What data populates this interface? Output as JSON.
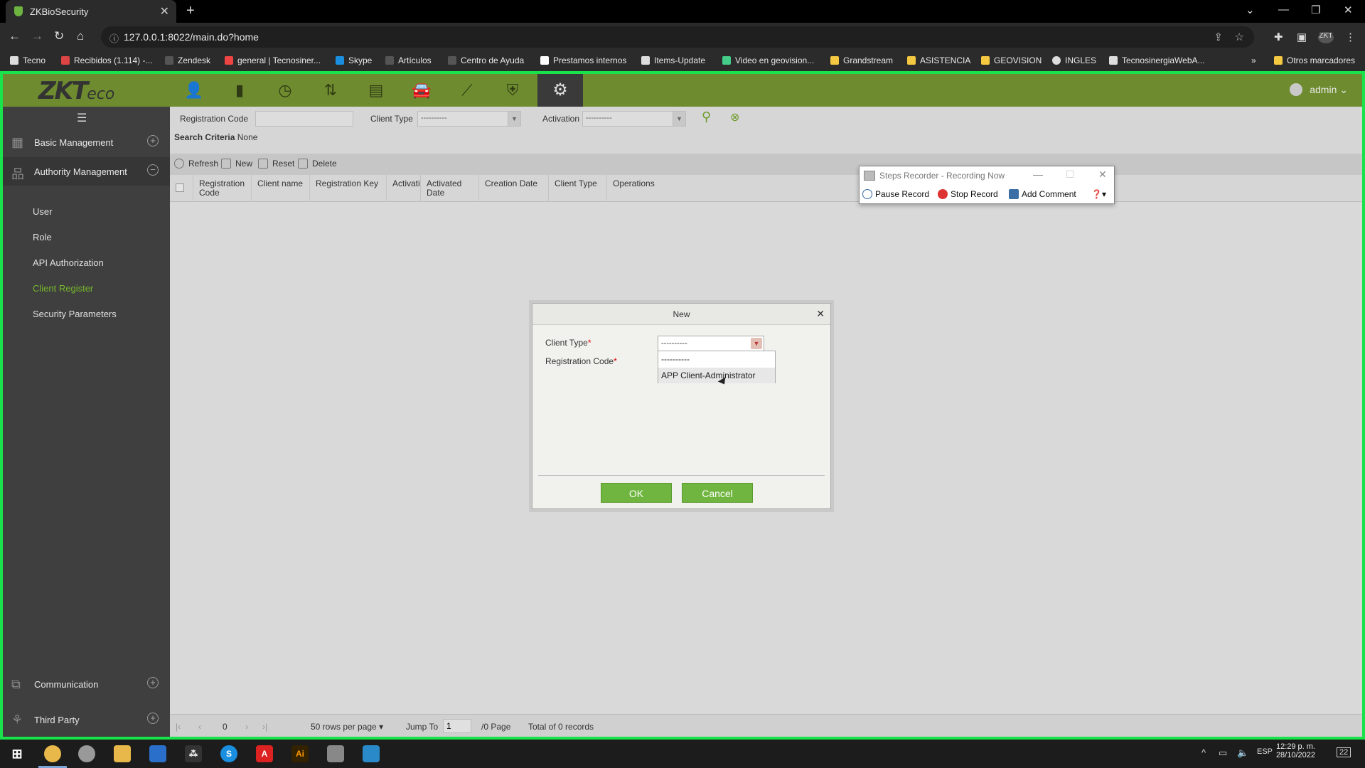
{
  "browser": {
    "tab_title": "ZKBioSecurity",
    "url": "127.0.0.1:8022/main.do?home",
    "bookmarks": [
      "Tecno",
      "Recibidos (1.114) -...",
      "Zendesk",
      "general | Tecnosiner...",
      "Skype",
      "Artículos",
      "Centro de Ayuda",
      "Prestamos internos",
      "Items-Update",
      "Video en geovision...",
      "Grandstream",
      "ASISTENCIA",
      "GEOVISION",
      "INGLES",
      "TecnosinergiaWebA..."
    ],
    "other_bookmarks": "Otros marcadores",
    "profile": "ZKT"
  },
  "header": {
    "logo": "ZKT",
    "logo_suffix": "eco",
    "user": "admin"
  },
  "sidebar": {
    "sections": {
      "basic": "Basic Management",
      "authority": "Authority Management",
      "communication": "Communication",
      "third_party": "Third Party"
    },
    "items": [
      "User",
      "Role",
      "API Authorization",
      "Client Register",
      "Security Parameters"
    ]
  },
  "filters": {
    "registration_code_label": "Registration Code",
    "client_type_label": "Client Type",
    "client_type_value": "----------",
    "activation_label": "Activation",
    "activation_value": "----------",
    "search_criteria_label": "Search Criteria",
    "search_criteria_value": "None"
  },
  "toolbar": {
    "refresh": "Refresh",
    "new": "New",
    "reset": "Reset",
    "delete": "Delete"
  },
  "table": {
    "columns": [
      "Registration Code",
      "Client name",
      "Registration Key",
      "Activation",
      "Activated Date",
      "Creation Date",
      "Client Type",
      "Operations"
    ]
  },
  "pager": {
    "page_index": "0",
    "rows_per_page": "50 rows per page",
    "jump_to_label": "Jump To",
    "jump_value": "1",
    "page_total": "/0 Page",
    "total_records": "Total of 0 records"
  },
  "modal": {
    "title": "New",
    "client_type_label": "Client Type",
    "registration_code_label": "Registration Code",
    "client_type_value": "----------",
    "options": [
      "----------",
      "APP Client-Administrator"
    ],
    "ok": "OK",
    "cancel": "Cancel"
  },
  "steps_recorder": {
    "title": "Steps Recorder - Recording Now",
    "pause": "Pause Record",
    "stop": "Stop Record",
    "comment": "Add Comment"
  },
  "taskbar": {
    "time": "12:29 p. m.",
    "date": "28/10/2022",
    "lang": "ESP",
    "notifications": "22"
  },
  "colors": {
    "header_green": "#6e8c2f",
    "accent_green": "#76b82a",
    "button_green": "#6fb53f",
    "frame_green": "#19e34a"
  }
}
